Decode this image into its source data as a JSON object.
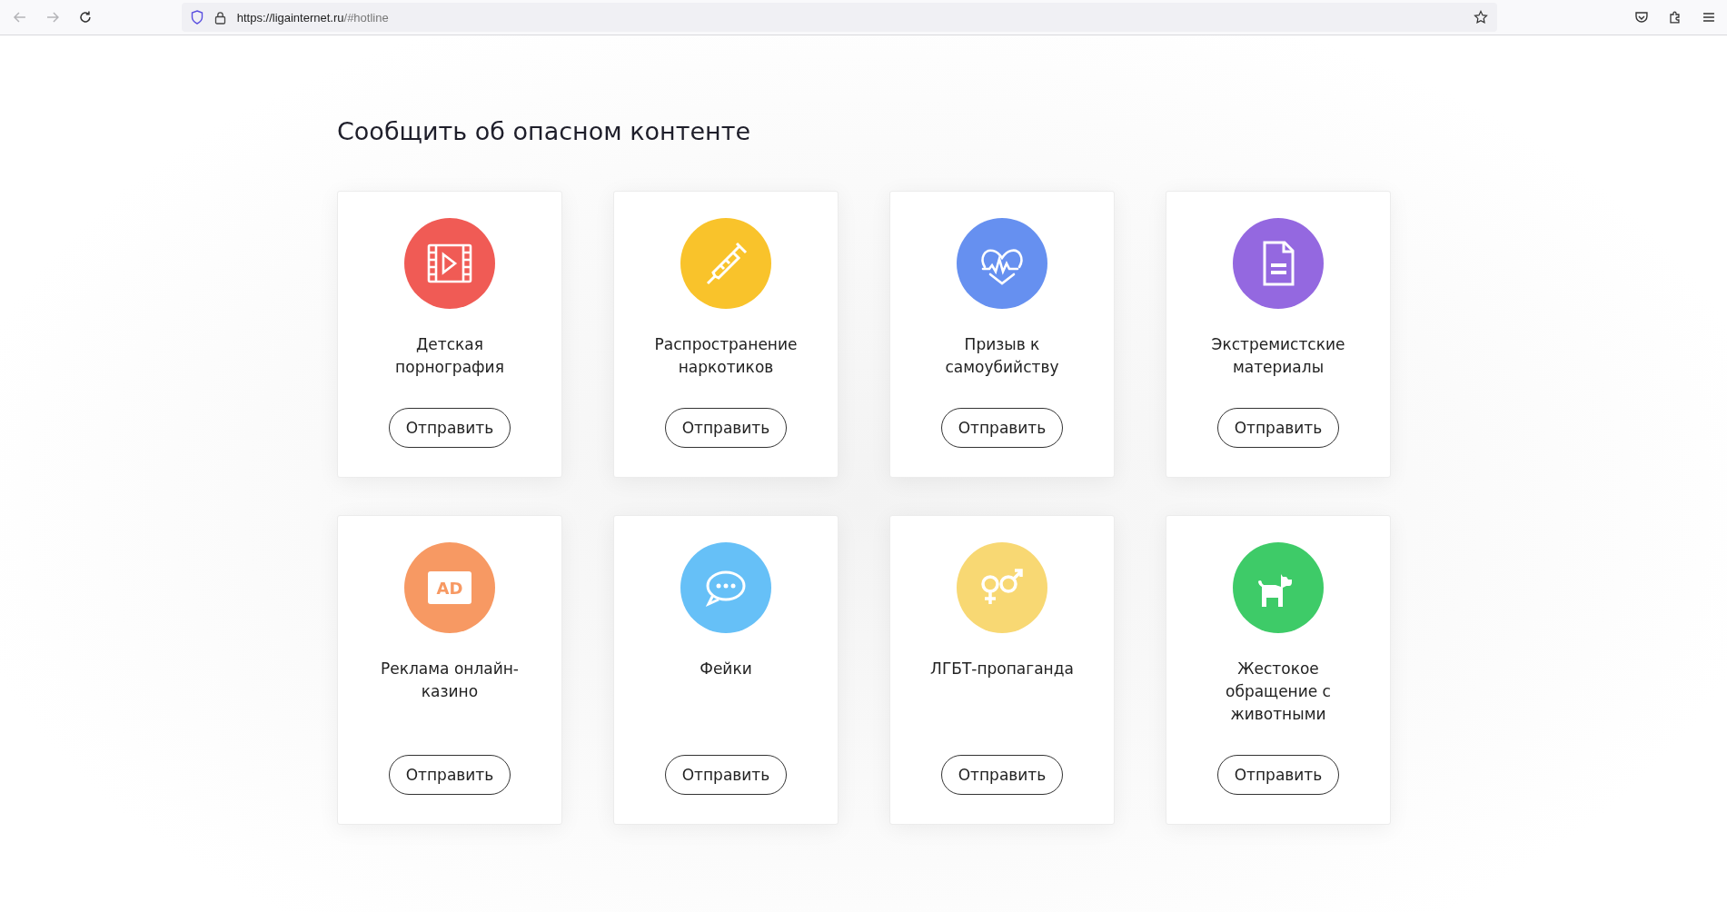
{
  "browser": {
    "url_host": "https://ligainternet.ru",
    "url_rest": "/#hotline"
  },
  "heading": "Сообщить об опасном контенте",
  "cards": [
    {
      "color": "#f05b55",
      "title": "Детская порнография",
      "button": "Отправить"
    },
    {
      "color": "#f9c32b",
      "title": "Распространение наркотиков",
      "button": "Отправить"
    },
    {
      "color": "#6690f0",
      "title": "Призыв к самоубийству",
      "button": "Отправить"
    },
    {
      "color": "#9468e0",
      "title": "Экстремистские материалы",
      "button": "Отправить"
    },
    {
      "icon_text": "AD",
      "color": "#f79963",
      "title": "Реклама онлайн-казино",
      "button": "Отправить"
    },
    {
      "color": "#66c0f7",
      "title": "Фейки",
      "button": "Отправить"
    },
    {
      "color": "#f8d873",
      "title": "ЛГБТ-пропаганда",
      "button": "Отправить"
    },
    {
      "color": "#3ecb68",
      "title": "Жестокое обращение с животными",
      "button": "Отправить"
    }
  ]
}
